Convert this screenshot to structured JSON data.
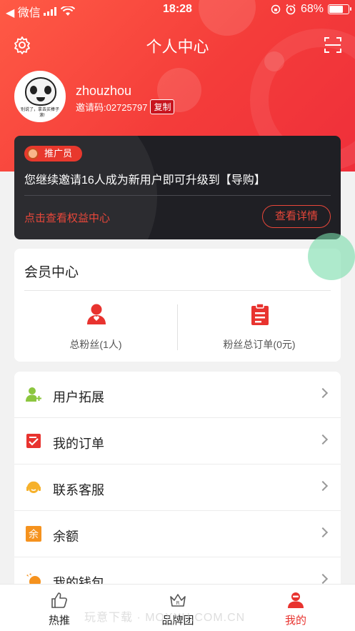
{
  "status_bar": {
    "carrier": "◀ 微信",
    "time": "18:28",
    "battery_percent": "68%",
    "battery_level": 0.68
  },
  "header": {
    "title": "个人中心",
    "settings_icon": "gear-icon",
    "scan_icon": "scan-icon"
  },
  "profile": {
    "username": "zhouzhou",
    "invite_code": "邀请码:02725797",
    "copy_label": "复制",
    "avatar_text": "别说了，拿去买棒子，滚!"
  },
  "promo": {
    "badge": "推广员",
    "message": "您继续邀请16人成为新用户即可升级到【导购】",
    "link": "点击查看权益中心",
    "button": "查看详情"
  },
  "member": {
    "title": "会员中心",
    "fans_label": "总粉丝(1人)",
    "orders_label": "粉丝总订单(0元)"
  },
  "menu": {
    "items": [
      {
        "label": "用户拓展",
        "icon": "user-add-icon"
      },
      {
        "label": "我的订单",
        "icon": "order-icon"
      },
      {
        "label": "联系客服",
        "icon": "customer-service-icon"
      },
      {
        "label": "余额",
        "icon": "balance-icon"
      },
      {
        "label": "我的钱包",
        "icon": "wallet-icon"
      }
    ]
  },
  "tabbar": {
    "tabs": [
      {
        "label": "热推"
      },
      {
        "label": "品牌团"
      },
      {
        "label": "我的"
      }
    ]
  },
  "watermark": "玩意下载 · MOXXH.COM.CN",
  "colors": {
    "brand_red": "#f43c3a",
    "accent_red": "#e9473a",
    "card_dark": "#1f1f24"
  }
}
